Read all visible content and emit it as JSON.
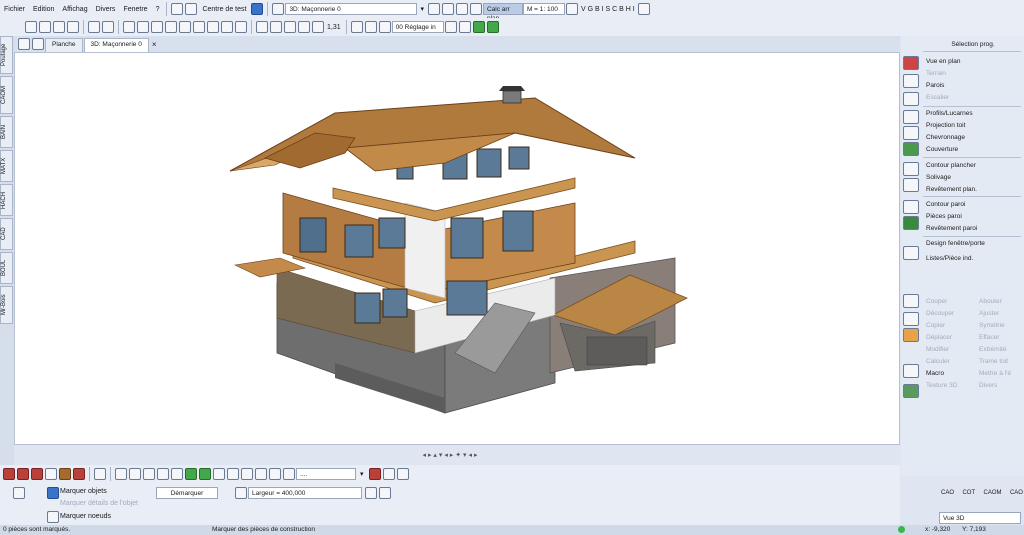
{
  "menu": [
    "Fichier",
    "Edition",
    "Affichag",
    "Divers",
    "Fenetre",
    "?"
  ],
  "toolbar": {
    "test_center_label": "Centre de test",
    "view_select_value": "3D: Maçonnerie 0",
    "calc_button": "Calc arr plan",
    "scale_value": "M = 1: 100",
    "layer_select": "00 Réglage in",
    "dim_value": "1,31"
  },
  "tabs": [
    {
      "label": "Planche"
    },
    {
      "label": "3D: Maçonnerie 0"
    }
  ],
  "left_tabs": [
    "Poutage",
    "CAOM",
    "BAIN",
    "MATX",
    "HACH",
    "CAD",
    "BOUL",
    "Mr-Bois"
  ],
  "right_panel": {
    "title": "Sélection prog.",
    "items": [
      {
        "label": "Vue en plan",
        "enabled": true
      },
      {
        "label": "Terrain",
        "enabled": false
      },
      {
        "label": "Parois",
        "enabled": true
      },
      {
        "label": "Escalier",
        "enabled": false
      },
      {
        "label": "Profils/Lucarnes",
        "enabled": true
      },
      {
        "label": "Projection toit",
        "enabled": true
      },
      {
        "label": "Chevronnage",
        "enabled": true
      },
      {
        "label": "Couverture",
        "enabled": true
      },
      {
        "label": "Contour plancher",
        "enabled": true
      },
      {
        "label": "Solivage",
        "enabled": true
      },
      {
        "label": "Revêtement plan.",
        "enabled": true
      },
      {
        "label": "Contour paroi",
        "enabled": true
      },
      {
        "label": "Pièces paroi",
        "enabled": true
      },
      {
        "label": "Revêtement paroi",
        "enabled": true
      },
      {
        "label": "Design fenêtre/porte",
        "enabled": true
      },
      {
        "label": "Listes/Pièce ind.",
        "enabled": true
      }
    ],
    "edit_left": [
      {
        "label": "Couper",
        "enabled": false
      },
      {
        "label": "Découper",
        "enabled": false
      },
      {
        "label": "Copier",
        "enabled": false
      },
      {
        "label": "Déplacer",
        "enabled": false
      },
      {
        "label": "Modifier",
        "enabled": false
      },
      {
        "label": "Calculer",
        "enabled": false
      },
      {
        "label": "Macro",
        "enabled": true
      },
      {
        "label": "Texture 3D",
        "enabled": false
      }
    ],
    "edit_right": [
      {
        "label": "Abouter",
        "enabled": false
      },
      {
        "label": "Ajuster",
        "enabled": false
      },
      {
        "label": "Symétrie",
        "enabled": false
      },
      {
        "label": "Effacer",
        "enabled": false
      },
      {
        "label": "Extrémité",
        "enabled": false
      },
      {
        "label": "Trame toit",
        "enabled": false
      },
      {
        "label": "Mettre à l'é",
        "enabled": false
      },
      {
        "label": "Divers",
        "enabled": false
      }
    ],
    "bottom_tabs": [
      "CAO",
      "COT",
      "CAOM",
      "CAO"
    ],
    "view_field": "Vue 3D"
  },
  "bottom": {
    "search_placeholder": "....",
    "option_primary": "Marquer objets",
    "option_secondary": "Marquer détails de l'objet",
    "option_nodes": "Marquer noeuds",
    "mark_button": "Démarquer",
    "width_value": "Largeur = 400,000"
  },
  "status": {
    "left": "0 pièces sont marqués.",
    "middle": "Marquer des pièces de construction",
    "x": "x: -9,320",
    "y": "Y: 7,193"
  }
}
